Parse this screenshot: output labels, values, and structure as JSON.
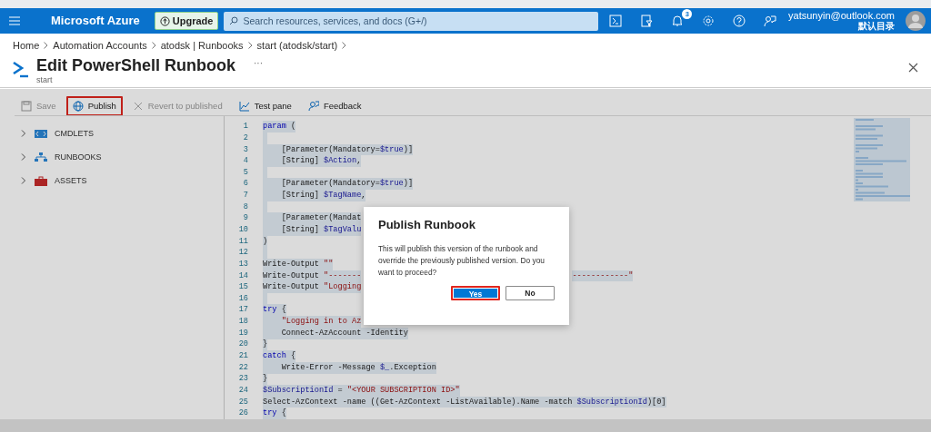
{
  "topbar": {
    "brand": "Microsoft Azure",
    "upgrade": "Upgrade",
    "search": {
      "placeholder": "Search resources, services, and docs (G+/)"
    },
    "icons": [
      {
        "kind": "terminal"
      },
      {
        "kind": "filter"
      },
      {
        "kind": "bell",
        "badge": "3"
      },
      {
        "kind": "gear"
      },
      {
        "kind": "help"
      },
      {
        "kind": "feedback"
      }
    ],
    "account": {
      "email": "yatsunyin@outlook.com",
      "directory": "默认目录"
    }
  },
  "breadcrumb": [
    "Home",
    "Automation Accounts",
    "atodsk | Runbooks",
    "start (atodsk/start)"
  ],
  "page": {
    "title": "Edit PowerShell Runbook",
    "more": "···",
    "subtitle": "start"
  },
  "toolbar": [
    {
      "kind": "save",
      "label": "Save",
      "disabled": true,
      "highlighted": false
    },
    {
      "kind": "publish",
      "label": "Publish",
      "disabled": false,
      "highlighted": true
    },
    {
      "kind": "revert",
      "label": "Revert to published",
      "disabled": true,
      "highlighted": false
    },
    {
      "kind": "test",
      "label": "Test pane",
      "disabled": false,
      "highlighted": false
    },
    {
      "kind": "feedback",
      "label": "Feedback",
      "disabled": false,
      "highlighted": false
    }
  ],
  "tree": [
    {
      "kind": "cmdlets",
      "label": "CMDLETS",
      "expanded": false
    },
    {
      "kind": "runbooks",
      "label": "RUNBOOKS",
      "expanded": false
    },
    {
      "kind": "assets",
      "label": "ASSETS",
      "expanded": false
    }
  ],
  "editor": {
    "lines": [
      {
        "number": "1",
        "selected": true,
        "tokens": [
          {
            "kind": "keyword",
            "text": "param"
          },
          {
            "kind": "plain",
            "text": " ("
          }
        ]
      },
      {
        "number": "2",
        "selected": true
      },
      {
        "number": "3",
        "selected": true,
        "tokens": [
          {
            "kind": "plain",
            "text": "    [Parameter(Mandatory="
          },
          {
            "kind": "variable",
            "text": "$true"
          },
          {
            "kind": "plain",
            "text": ")]"
          }
        ]
      },
      {
        "number": "4",
        "selected": true,
        "tokens": [
          {
            "kind": "plain",
            "text": "    [String] "
          },
          {
            "kind": "variable",
            "text": "$Action"
          },
          {
            "kind": "plain",
            "text": ","
          }
        ]
      },
      {
        "number": "5",
        "selected": true
      },
      {
        "number": "6",
        "selected": true,
        "tokens": [
          {
            "kind": "plain",
            "text": "    [Parameter(Mandatory="
          },
          {
            "kind": "variable",
            "text": "$true"
          },
          {
            "kind": "plain",
            "text": ")]"
          }
        ]
      },
      {
        "number": "7",
        "selected": true,
        "tokens": [
          {
            "kind": "plain",
            "text": "    [String] "
          },
          {
            "kind": "variable",
            "text": "$TagName"
          },
          {
            "kind": "plain",
            "text": ","
          }
        ]
      },
      {
        "number": "8",
        "selected": true
      },
      {
        "number": "9",
        "selected": true,
        "tokens": [
          {
            "kind": "plain",
            "text": "    [Parameter(Mandat"
          }
        ]
      },
      {
        "number": "10",
        "selected": true,
        "tokens": [
          {
            "kind": "plain",
            "text": "    [String] "
          },
          {
            "kind": "variable",
            "text": "$TagValu"
          }
        ]
      },
      {
        "number": "11",
        "selected": true,
        "tokens": [
          {
            "kind": "plain",
            "text": ")"
          }
        ]
      },
      {
        "number": "12",
        "selected": true
      },
      {
        "number": "13",
        "selected": true,
        "tokens": [
          {
            "kind": "plain",
            "text": "Write-Output "
          },
          {
            "kind": "string",
            "text": "\"\""
          }
        ]
      },
      {
        "number": "14",
        "selected": true,
        "tokens": [
          {
            "kind": "plain",
            "text": "Write-Output "
          },
          {
            "kind": "string",
            "text": "\"-------"
          }
        ],
        "tail": "------------\""
      },
      {
        "number": "15",
        "selected": true,
        "tokens": [
          {
            "kind": "plain",
            "text": "Write-Output "
          },
          {
            "kind": "string",
            "text": "\"Logging"
          }
        ]
      },
      {
        "number": "16",
        "selected": true
      },
      {
        "number": "17",
        "selected": true,
        "tokens": [
          {
            "kind": "keyword",
            "text": "try"
          },
          {
            "kind": "plain",
            "text": " {"
          }
        ]
      },
      {
        "number": "18",
        "selected": true,
        "tokens": [
          {
            "kind": "string",
            "text": "    \"Logging in to Az"
          }
        ]
      },
      {
        "number": "19",
        "selected": true,
        "tokens": [
          {
            "kind": "plain",
            "text": "    Connect-AzAccount -Identity"
          }
        ]
      },
      {
        "number": "20",
        "selected": true,
        "tokens": [
          {
            "kind": "plain",
            "text": "}"
          }
        ]
      },
      {
        "number": "21",
        "selected": true,
        "tokens": [
          {
            "kind": "keyword",
            "text": "catch"
          },
          {
            "kind": "plain",
            "text": " {"
          }
        ]
      },
      {
        "number": "22",
        "selected": true,
        "tokens": [
          {
            "kind": "plain",
            "text": "    Write-Error -Message "
          },
          {
            "kind": "variable",
            "text": "$_"
          },
          {
            "kind": "plain",
            "text": ".Exception"
          }
        ]
      },
      {
        "number": "23",
        "selected": true,
        "tokens": [
          {
            "kind": "plain",
            "text": "}"
          }
        ]
      },
      {
        "number": "24",
        "selected": true,
        "tokens": [
          {
            "kind": "variable",
            "text": "$SubscriptionId"
          },
          {
            "kind": "plain",
            "text": " = "
          },
          {
            "kind": "string",
            "text": "\"<YOUR SUBSCRIPTION ID>\""
          }
        ]
      },
      {
        "number": "25",
        "selected": true,
        "tokens": [
          {
            "kind": "plain",
            "text": "Select-AzContext -name ((Get-AzContext -ListAvailable).Name -match "
          },
          {
            "kind": "variable",
            "text": "$SubscriptionId"
          },
          {
            "kind": "plain",
            "text": ")[0]"
          }
        ]
      },
      {
        "number": "26",
        "selected": true,
        "tokens": [
          {
            "kind": "keyword",
            "text": "try"
          },
          {
            "kind": "plain",
            "text": " {"
          }
        ]
      }
    ]
  },
  "dialog": {
    "title": "Publish Runbook",
    "message": "This will publish this version of the runbook and override the previously published version. Do you want to proceed?",
    "buttons": [
      {
        "label": "Yes",
        "primary": true,
        "highlighted": true
      },
      {
        "label": "No",
        "primary": false,
        "highlighted": false
      }
    ]
  }
}
